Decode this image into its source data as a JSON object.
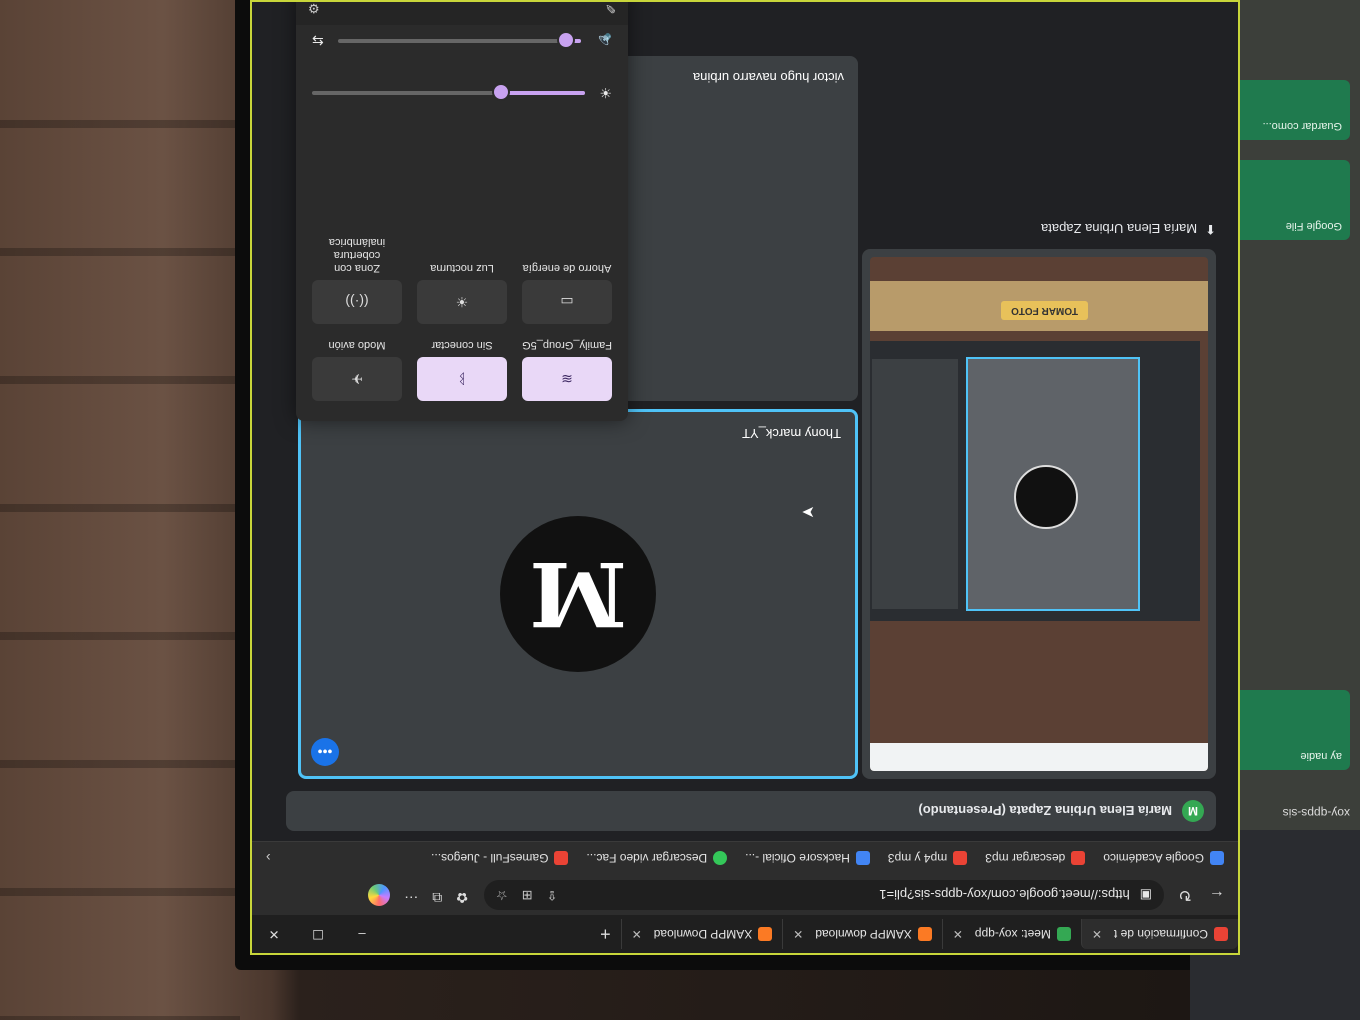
{
  "browser": {
    "tabs": [
      {
        "label": "Confirmación de t",
        "icon": "gmail-icon",
        "color": "#ea4335",
        "active": true
      },
      {
        "label": "Meet: xoy-qpp",
        "icon": "meet-icon",
        "color": "#34a853",
        "active": false
      },
      {
        "label": "XAMPP download",
        "icon": "xampp-icon",
        "color": "#fb7a24",
        "active": false
      },
      {
        "label": "XAMPP Download",
        "icon": "xampp-icon",
        "color": "#fb7a24",
        "active": false
      }
    ],
    "new_tab": "+",
    "window_controls": {
      "minimize": "–",
      "maximize": "☐",
      "close": "✕"
    },
    "url": "https://meet.google.com/xoy-qpps-sis?pli=1",
    "url_host": "meet.google.com",
    "bookmarks": [
      {
        "label": "Google Académico",
        "color": "#4285f4"
      },
      {
        "label": "descargar mp3",
        "color": "#ea4335"
      },
      {
        "label": "mp4 y mp3",
        "color": "#ea4335"
      },
      {
        "label": "Hacksore Oficial -...",
        "color": "#4285f4"
      },
      {
        "label": "Descargar video Fac...",
        "color": "#34c759"
      },
      {
        "label": "GamesFull - Juegos...",
        "color": "#ea4335"
      }
    ],
    "bookmarks_more": "›"
  },
  "meet": {
    "presenting_banner": "María Elena Urbina Zapata (Presentando)",
    "presenting_badge": "M",
    "presenter_tile_label": "María Elena Urbina Zapata",
    "take_photo": "TOMAR FOTO",
    "participants": [
      {
        "name": "Thony marck_YT",
        "initial": "M"
      },
      {
        "name": "victor hugo navarro urbina",
        "initial": ""
      }
    ]
  },
  "quick_settings": {
    "toggles": [
      {
        "label": "Family_Group_5G",
        "icon": "wifi-icon",
        "glyph": "≋",
        "on": true
      },
      {
        "label": "Sin conectar",
        "icon": "bluetooth-icon",
        "glyph": "ᛒ",
        "on": true
      },
      {
        "label": "Modo avión",
        "icon": "airplane-icon",
        "glyph": "✈",
        "on": false
      },
      {
        "label": "Ahorro de energía",
        "icon": "battery-saver-icon",
        "glyph": "▭",
        "on": false
      },
      {
        "label": "Luz nocturna",
        "icon": "night-light-icon",
        "glyph": "☀",
        "on": false
      },
      {
        "label": "Zona con cobertura inalámbrica",
        "icon": "hotspot-icon",
        "glyph": "((·))",
        "on": false
      }
    ],
    "brightness": 0.3,
    "volume": 0.05
  },
  "side_window": {
    "title": "xoy-qpps-sis",
    "cards": [
      "Guardar como...",
      "Google File"
    ],
    "footer": "ay nadie"
  },
  "colors": {
    "accent_frame": "#c8d63a",
    "active_tile_border": "#4fc3f7",
    "meet_green": "#34a853"
  }
}
